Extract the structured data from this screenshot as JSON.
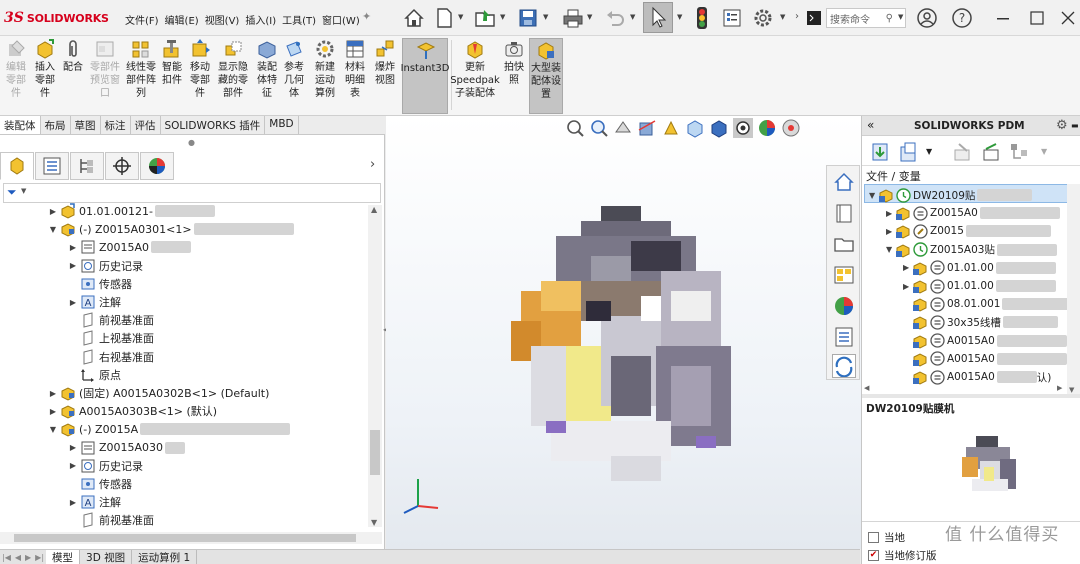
{
  "app": {
    "name": "SOLIDWORKS"
  },
  "menu": [
    "文件(F)",
    "编辑(E)",
    "视图(V)",
    "插入(I)",
    "工具(T)",
    "窗口(W)"
  ],
  "search": {
    "placeholder": "搜索命令"
  },
  "ribbon": {
    "buttons": [
      {
        "label": "编辑\n零部\n件",
        "disabled": true
      },
      {
        "label": "插入\n零部\n件"
      },
      {
        "label": "配合"
      },
      {
        "label": "零部件\n预览窗\n口",
        "disabled": true
      },
      {
        "label": "线性零\n部件阵\n列"
      },
      {
        "label": "智能\n扣件"
      },
      {
        "label": "移动\n零部\n件"
      },
      {
        "label": "显示隐\n藏的零\n部件"
      },
      {
        "label": "装配\n体特\n征"
      },
      {
        "label": "参考\n几何\n体"
      },
      {
        "label": "新建\n运动\n算例"
      },
      {
        "label": "材料\n明细\n表"
      },
      {
        "label": "爆炸\n视图"
      },
      {
        "label": "Instant3D",
        "selected": true
      },
      {
        "label": "更新\nSpeedpak\n子装配体"
      },
      {
        "label": "拍快\n照"
      },
      {
        "label": "大型装\n配体设\n置",
        "selected": true
      }
    ]
  },
  "command_tabs": [
    "装配体",
    "布局",
    "草图",
    "标注",
    "评估",
    "SOLIDWORKS 插件",
    "MBD"
  ],
  "tree": [
    {
      "text": "01.01.00121-",
      "indent": 1,
      "expander": "right",
      "icon": "part-icon"
    },
    {
      "text": "(-) Z0015A0301<1>",
      "indent": 1,
      "expander": "down",
      "icon": "assembly-icon"
    },
    {
      "text": "Z0015A0",
      "indent": 2,
      "expander": "right",
      "icon": "config-icon"
    },
    {
      "text": "历史记录",
      "indent": 2,
      "expander": "right",
      "icon": "history-icon"
    },
    {
      "text": "传感器",
      "indent": 2,
      "expander": "",
      "icon": "sensor-icon"
    },
    {
      "text": "注解",
      "indent": 2,
      "expander": "right",
      "icon": "annotation-icon"
    },
    {
      "text": "前视基准面",
      "indent": 2,
      "expander": "",
      "icon": "plane-icon"
    },
    {
      "text": "上视基准面",
      "indent": 2,
      "expander": "",
      "icon": "plane-icon"
    },
    {
      "text": "右视基准面",
      "indent": 2,
      "expander": "",
      "icon": "plane-icon"
    },
    {
      "text": "原点",
      "indent": 2,
      "expander": "",
      "icon": "origin-icon"
    },
    {
      "text": "(固定) A0015A0302B<1> (Default)",
      "indent": 1,
      "expander": "right",
      "icon": "assembly-icon"
    },
    {
      "text": "A0015A0303B<1> (默认)",
      "indent": 1,
      "expander": "right",
      "icon": "assembly-icon"
    },
    {
      "text": "(-) Z0015A",
      "indent": 1,
      "expander": "down",
      "icon": "assembly-icon"
    },
    {
      "text": "Z0015A030",
      "indent": 2,
      "expander": "right",
      "icon": "config-icon"
    },
    {
      "text": "历史记录",
      "indent": 2,
      "expander": "right",
      "icon": "history-icon"
    },
    {
      "text": "传感器",
      "indent": 2,
      "expander": "",
      "icon": "sensor-icon"
    },
    {
      "text": "注解",
      "indent": 2,
      "expander": "right",
      "icon": "annotation-icon"
    },
    {
      "text": "前视基准面",
      "indent": 2,
      "expander": "",
      "icon": "plane-icon"
    }
  ],
  "bottom_tabs": [
    "模型",
    "3D 视图",
    "运动算例 1"
  ],
  "pdm": {
    "title": "SOLIDWORKS PDM",
    "column_header": "文件 / 变量",
    "rows": [
      {
        "text": "DW20109贴",
        "indent": 0,
        "expander": "down",
        "state": "checked-in",
        "selected": true
      },
      {
        "text": "Z0015A0",
        "indent": 1,
        "expander": "right",
        "state": "normal"
      },
      {
        "text": "Z0015",
        "indent": 1,
        "expander": "right",
        "state": "edit"
      },
      {
        "text": "Z0015A03贴",
        "indent": 1,
        "expander": "down",
        "state": "checked-in"
      },
      {
        "text": "01.01.00",
        "indent": 2,
        "expander": "right",
        "state": "normal"
      },
      {
        "text": "01.01.00",
        "indent": 2,
        "expander": "right",
        "state": "normal"
      },
      {
        "text": "08.01.001",
        "indent": 2,
        "expander": "",
        "state": "normal"
      },
      {
        "text": "30x35线槽",
        "indent": 2,
        "expander": "",
        "state": "normal"
      },
      {
        "text": "A0015A0",
        "indent": 2,
        "expander": "",
        "state": "normal"
      },
      {
        "text": "A0015A0",
        "indent": 2,
        "expander": "",
        "state": "normal"
      },
      {
        "text": "A0015A0",
        "indent": 2,
        "expander": "",
        "state": "normal",
        "suffix": "认)"
      }
    ],
    "preview_title": "DW20109贴膜机",
    "footer": [
      {
        "label": "当地",
        "checked": false
      },
      {
        "label": "当地修订版",
        "checked": true
      }
    ]
  },
  "watermark": "值 什么值得买",
  "colors": {
    "brand": "#d6001c",
    "selection": "#cfe3f7",
    "part_yellow": "#f2c230",
    "part_blue": "#3b6fbf"
  }
}
